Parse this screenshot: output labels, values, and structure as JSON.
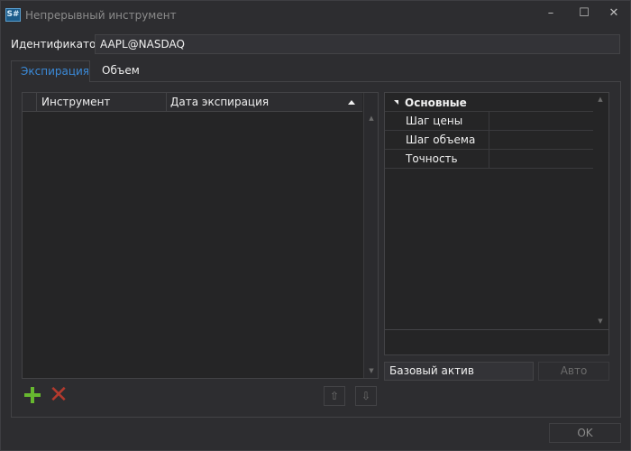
{
  "window": {
    "title": "Непрерывный инструмент",
    "icon_text": "S#",
    "buttons": {
      "minimize": "–",
      "maximize": "☐",
      "close": "✕"
    }
  },
  "identifier": {
    "label": "Идентификатор:",
    "value": "AAPL@NASDAQ"
  },
  "tabs": [
    {
      "label": "Экспирация",
      "active": true
    },
    {
      "label": "Объем",
      "active": false
    }
  ],
  "grid": {
    "columns": [
      "Инструмент",
      "Дата экспирация"
    ],
    "sort": {
      "column": "Дата экспирация",
      "direction": "ascending"
    },
    "rows": []
  },
  "properties": {
    "category": "Основные",
    "items": [
      {
        "name": "Шаг цены",
        "value": ""
      },
      {
        "name": "Шаг объема",
        "value": ""
      },
      {
        "name": "Точность",
        "value": ""
      }
    ]
  },
  "asset": {
    "placeholder": "Базовый актив",
    "auto_label": "Авто"
  },
  "footer": {
    "ok_label": "OK"
  },
  "icons": {
    "add": "plus-icon",
    "remove": "delete-icon",
    "move_up": "arrow-up-icon",
    "move_down": "arrow-down-icon",
    "move_up_glyph": "⇧",
    "move_down_glyph": "⇩"
  },
  "colors": {
    "background": "#2d2d30",
    "accent": "#3b8ad8",
    "add": "#67b82f",
    "remove": "#b33a2e"
  }
}
